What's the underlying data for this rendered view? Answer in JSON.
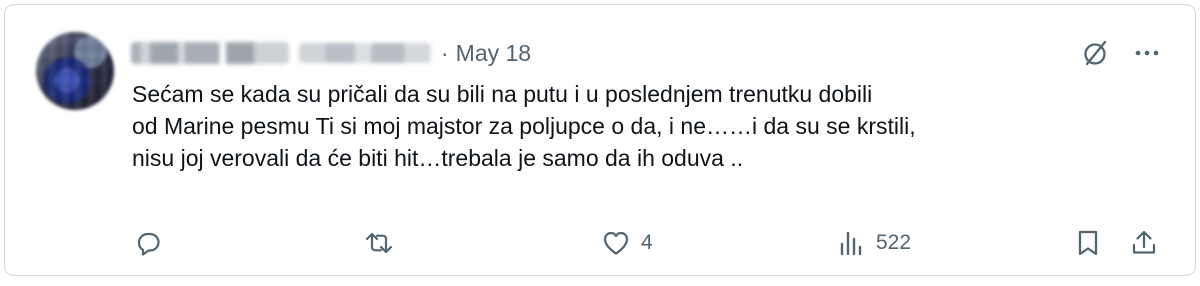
{
  "tweet": {
    "date": "May 18",
    "separator": "·",
    "text_lines": [
      "Sećam se kada su pričali da su bili na putu i u poslednjem trenutku dobili",
      "od Marine pesmu Ti si moj majstor za poljupce o da, i ne……i da su se krstili,",
      "nisu joj verovali da će biti hit…trebala je samo da ih oduva .."
    ]
  },
  "actions": {
    "reply": {
      "icon": "reply-icon",
      "count": ""
    },
    "retweet": {
      "icon": "retweet-icon",
      "count": ""
    },
    "like": {
      "icon": "heart-icon",
      "count": "4"
    },
    "views": {
      "icon": "analytics-icon",
      "count": "522"
    },
    "bookmark": {
      "icon": "bookmark-icon"
    },
    "share": {
      "icon": "share-icon"
    }
  },
  "colors": {
    "text": "#0f1419",
    "secondary": "#536471",
    "border": "#cfd9de"
  }
}
